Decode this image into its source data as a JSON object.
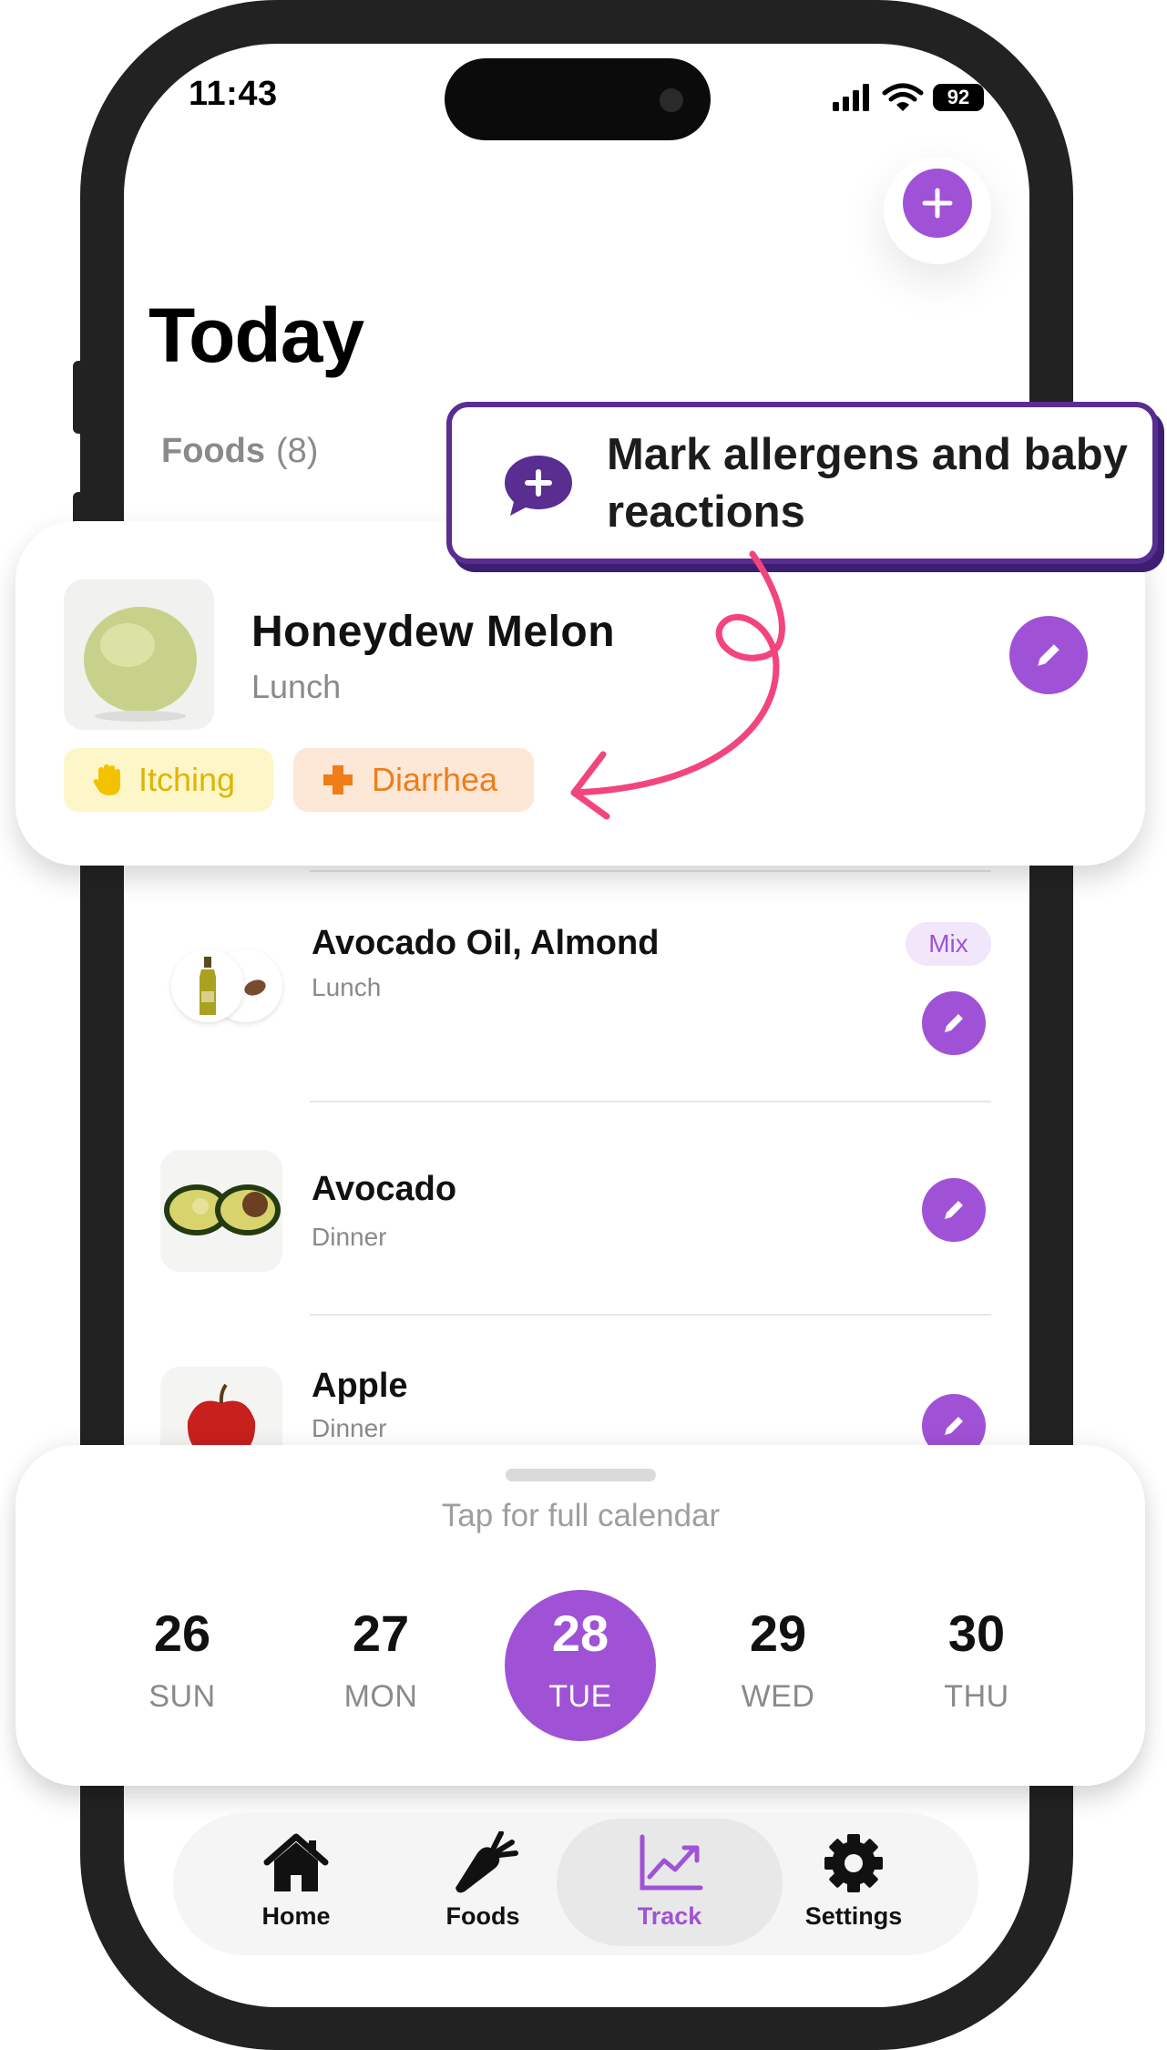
{
  "status_bar": {
    "time": "11:43",
    "battery": "92"
  },
  "header": {
    "title": "Today",
    "foods_tab_label": "Foods",
    "foods_tab_count": "(8)"
  },
  "tooltip": {
    "text": "Mark allergens and baby reactions"
  },
  "featured_food": {
    "name": "Honeydew Melon",
    "meal": "Lunch",
    "reactions": [
      {
        "label": "Itching",
        "icon": "raised-hand-icon",
        "color": "#e0b400"
      },
      {
        "label": "Diarrhea",
        "icon": "plus-cross-icon",
        "color": "#f07d18"
      }
    ]
  },
  "food_list": [
    {
      "name": "Avocado Oil, Almond",
      "meal": "Lunch",
      "badge": "Mix"
    },
    {
      "name": "Avocado",
      "meal": "Dinner"
    },
    {
      "name": "Apple",
      "meal": "Dinner"
    }
  ],
  "calendar": {
    "hint": "Tap for full calendar",
    "days": [
      {
        "num": "26",
        "name": "SUN"
      },
      {
        "num": "27",
        "name": "MON"
      },
      {
        "num": "28",
        "name": "TUE",
        "selected": true
      },
      {
        "num": "29",
        "name": "WED"
      },
      {
        "num": "30",
        "name": "THU"
      }
    ]
  },
  "tabbar": {
    "tabs": [
      {
        "label": "Home",
        "icon": "home-icon"
      },
      {
        "label": "Foods",
        "icon": "carrot-icon"
      },
      {
        "label": "Track",
        "icon": "chart-trend-icon",
        "active": true
      },
      {
        "label": "Settings",
        "icon": "gear-icon"
      }
    ]
  },
  "colors": {
    "accent": "#a052d6",
    "tooltip_border": "#5a2d91",
    "arrow": "#f2457c"
  }
}
